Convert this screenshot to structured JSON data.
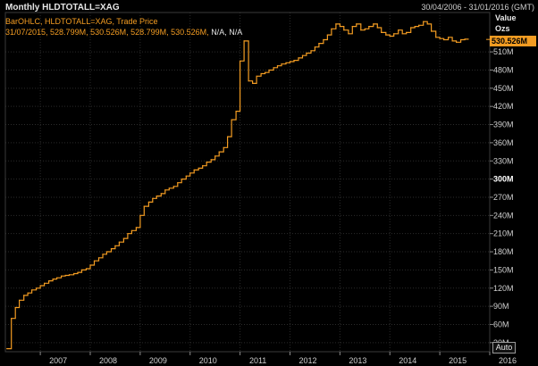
{
  "header": {
    "title": "Monthly HLDTOTALL=XAG",
    "date_range": "30/04/2006 - 31/01/2016 (GMT)"
  },
  "legend": {
    "line1": "BarOHLC, HLDTOTALL=XAG, Trade Price",
    "line2_values": "31/07/2015, 528.799M, 530.526M, 528.799M, 530.526M,",
    "line2_na": "N/A, N/A"
  },
  "axis_caption": {
    "line1": "Value",
    "line2": "Ozs"
  },
  "last_value_tag": "530.526M",
  "auto_button": "Auto",
  "colors": {
    "series": "#f39c22",
    "background": "#000000",
    "grid": "#2b2b2b",
    "axis_text": "#d0d0d0"
  },
  "chart_data": {
    "type": "line",
    "style": "step",
    "x_unit": "year",
    "xlim": [
      2006.3,
      2016.0
    ],
    "ylim": [
      15,
      575
    ],
    "y_unit": "M ozs",
    "x_ticks": [
      {
        "value": 2007,
        "label": "2007"
      },
      {
        "value": 2008,
        "label": "2008"
      },
      {
        "value": 2009,
        "label": "2009"
      },
      {
        "value": 2010,
        "label": "2010"
      },
      {
        "value": 2011,
        "label": "2011"
      },
      {
        "value": 2012,
        "label": "2012"
      },
      {
        "value": 2013,
        "label": "2013"
      },
      {
        "value": 2014,
        "label": "2014"
      },
      {
        "value": 2015,
        "label": "2015"
      },
      {
        "value": 2016,
        "label": "2016"
      }
    ],
    "y_ticks": [
      {
        "value": 30,
        "label": "30M"
      },
      {
        "value": 60,
        "label": "60M"
      },
      {
        "value": 90,
        "label": "90M"
      },
      {
        "value": 120,
        "label": "120M"
      },
      {
        "value": 150,
        "label": "150M"
      },
      {
        "value": 180,
        "label": "180M"
      },
      {
        "value": 210,
        "label": "210M"
      },
      {
        "value": 240,
        "label": "240M"
      },
      {
        "value": 270,
        "label": "270M"
      },
      {
        "value": 300,
        "label": "300M",
        "major": true
      },
      {
        "value": 330,
        "label": "330M"
      },
      {
        "value": 360,
        "label": "360M"
      },
      {
        "value": 390,
        "label": "390M"
      },
      {
        "value": 420,
        "label": "420M"
      },
      {
        "value": 450,
        "label": "450M"
      },
      {
        "value": 480,
        "label": "480M"
      },
      {
        "value": 510,
        "label": "510M"
      }
    ],
    "grid": true,
    "last_value": 530.526,
    "series": [
      {
        "x": [
          2006.33,
          2006.42,
          2006.5,
          2006.58,
          2006.67,
          2006.75,
          2006.83,
          2006.92,
          2007.0,
          2007.08,
          2007.17,
          2007.25,
          2007.33,
          2007.42,
          2007.5,
          2007.58,
          2007.67,
          2007.75,
          2007.83,
          2007.92,
          2008.0,
          2008.08,
          2008.17,
          2008.25,
          2008.33,
          2008.42,
          2008.5,
          2008.58,
          2008.67,
          2008.75,
          2008.83,
          2008.92,
          2009.0,
          2009.08,
          2009.17,
          2009.25,
          2009.33,
          2009.42,
          2009.5,
          2009.58,
          2009.67,
          2009.75,
          2009.83,
          2009.92,
          2010.0,
          2010.08,
          2010.17,
          2010.25,
          2010.33,
          2010.42,
          2010.5,
          2010.58,
          2010.67,
          2010.75,
          2010.83,
          2010.92,
          2011.0,
          2011.08,
          2011.17,
          2011.25,
          2011.33,
          2011.42,
          2011.5,
          2011.58,
          2011.67,
          2011.75,
          2011.83,
          2011.92,
          2012.0,
          2012.08,
          2012.17,
          2012.25,
          2012.33,
          2012.42,
          2012.5,
          2012.58,
          2012.67,
          2012.75,
          2012.83,
          2012.92,
          2013.0,
          2013.08,
          2013.17,
          2013.25,
          2013.33,
          2013.42,
          2013.5,
          2013.58,
          2013.67,
          2013.75,
          2013.83,
          2013.92,
          2014.0,
          2014.08,
          2014.17,
          2014.25,
          2014.33,
          2014.42,
          2014.5,
          2014.58,
          2014.67,
          2014.75,
          2014.83,
          2014.92,
          2015.0,
          2015.08,
          2015.17,
          2015.25,
          2015.33,
          2015.42,
          2015.5
        ],
        "y": [
          20,
          70,
          88,
          100,
          108,
          112,
          117,
          120,
          124,
          128,
          132,
          135,
          137,
          140,
          141,
          142,
          144,
          146,
          150,
          152,
          158,
          165,
          170,
          176,
          180,
          185,
          190,
          196,
          202,
          210,
          215,
          220,
          240,
          255,
          262,
          268,
          272,
          276,
          282,
          285,
          288,
          294,
          300,
          305,
          310,
          315,
          318,
          322,
          328,
          332,
          338,
          345,
          352,
          370,
          398,
          412,
          495,
          528,
          462,
          458,
          470,
          474,
          476,
          480,
          484,
          487,
          490,
          492,
          494,
          496,
          500,
          504,
          508,
          512,
          518,
          524,
          530,
          538,
          548,
          556,
          552,
          546,
          540,
          552,
          556,
          546,
          548,
          552,
          556,
          550,
          542,
          538,
          536,
          540,
          546,
          540,
          542,
          550,
          552,
          554,
          560,
          556,
          544,
          534,
          532,
          530,
          534,
          528,
          526,
          530,
          531
        ]
      }
    ]
  }
}
